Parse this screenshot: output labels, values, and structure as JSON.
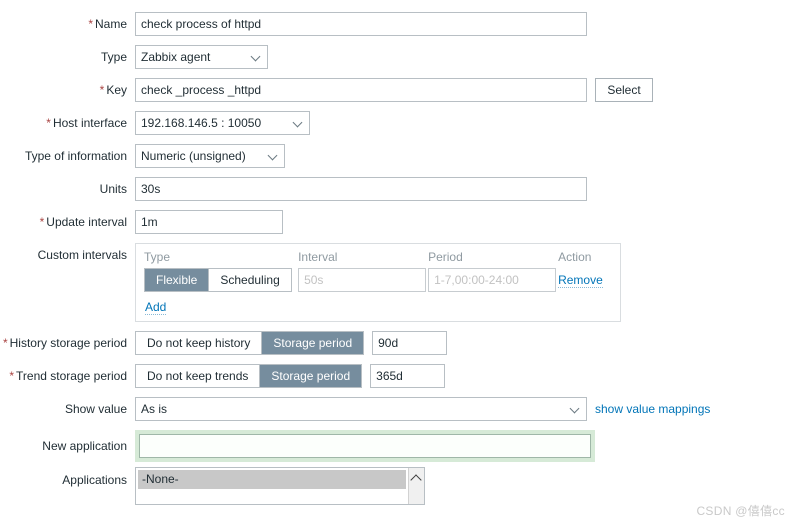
{
  "form": {
    "name": {
      "label": "Name",
      "required": "*",
      "value": "check process of httpd",
      "placeholder": ""
    },
    "type": {
      "label": "Type",
      "value": "Zabbix agent",
      "icon": "chevron-down-icon"
    },
    "key": {
      "label": "Key",
      "required": "*",
      "value": "check _process _httpd",
      "placeholder": "",
      "select_button": "Select"
    },
    "host_interface": {
      "label": "Host interface",
      "required": "*",
      "value": "192.168.146.5 : 10050",
      "icon": "chevron-down-icon"
    },
    "type_of_information": {
      "label": "Type of information",
      "value": "Numeric (unsigned)",
      "icon": "chevron-down-icon"
    },
    "units": {
      "label": "Units",
      "value": "30s",
      "placeholder": ""
    },
    "update_interval": {
      "label": "Update interval",
      "required": "*",
      "value": "1m",
      "placeholder": ""
    },
    "custom_intervals": {
      "label": "Custom intervals",
      "headers": {
        "type": "Type",
        "interval": "Interval",
        "period": "Period",
        "action": "Action"
      },
      "rows": [
        {
          "type_options": [
            "Flexible",
            "Scheduling"
          ],
          "type_selected": "Flexible",
          "interval_value": "",
          "interval_placeholder": "50s",
          "period_value": "",
          "period_placeholder": "1-7,00:00-24:00",
          "action_label": "Remove"
        }
      ],
      "add_label": "Add"
    },
    "history_storage_period": {
      "label": "History storage period",
      "required": "*",
      "options": [
        "Do not keep history",
        "Storage period"
      ],
      "selected": "Storage period",
      "value": "90d"
    },
    "trend_storage_period": {
      "label": "Trend storage period",
      "required": "*",
      "options": [
        "Do not keep trends",
        "Storage period"
      ],
      "selected": "Storage period",
      "value": "365d"
    },
    "show_value": {
      "label": "Show value",
      "value": "As is",
      "icon": "chevron-down-icon",
      "link_label": "show value mappings"
    },
    "new_application": {
      "label": "New application",
      "value": "",
      "placeholder": ""
    },
    "applications": {
      "label": "Applications",
      "options": [
        "-None-"
      ],
      "selected": "-None-",
      "scroll_icon": "chevron-up-icon"
    }
  },
  "watermark": "CSDN @僖僖cc",
  "colors": {
    "accent_toggle_on": "#768d9e",
    "link": "#0275b8",
    "required_asterisk": "#a94442",
    "focus_border": "#2e6b7d",
    "highlight_green": "#d6ead7"
  }
}
